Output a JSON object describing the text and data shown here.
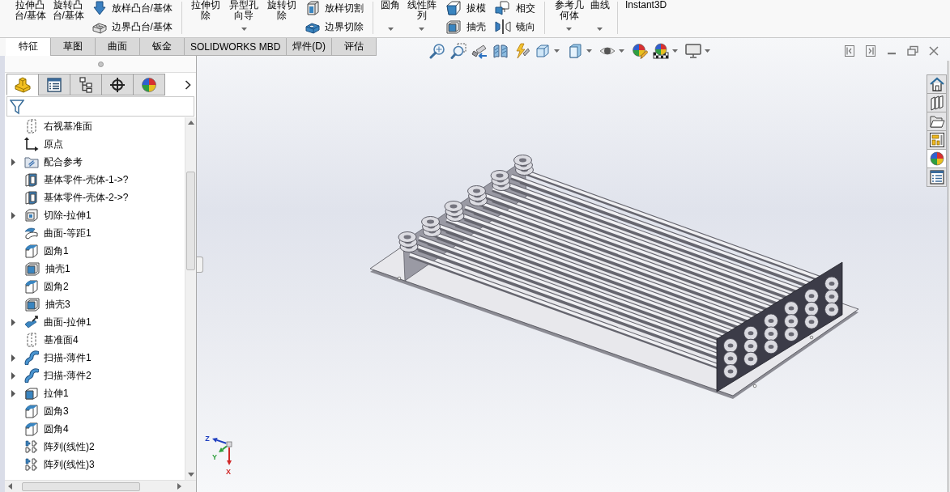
{
  "ribbon": {
    "groups": [
      {
        "items": [
          {
            "kind": "large",
            "label": "拉伸凸台/基体",
            "dropdown": false
          },
          {
            "kind": "large",
            "label": "旋转凸台/基体",
            "dropdown": false
          },
          {
            "kind": "stack",
            "buttons": [
              {
                "kind": "loft",
                "label": "放样凸台/基体"
              },
              {
                "kind": "boundary",
                "label": "边界凸台/基体"
              }
            ]
          }
        ]
      },
      {
        "items": [
          {
            "kind": "large",
            "label": "拉伸切除",
            "dropdown": false
          },
          {
            "kind": "large",
            "label": "异型孔向导",
            "dropdown": true
          },
          {
            "kind": "large",
            "label": "旋转切除",
            "dropdown": false
          },
          {
            "kind": "stack",
            "buttons": [
              {
                "kind": "loft-cut",
                "label": "放样切割"
              },
              {
                "kind": "boundary-cut",
                "label": "边界切除"
              }
            ]
          }
        ]
      },
      {
        "items": [
          {
            "kind": "large",
            "label": "圆角",
            "dropdown": true
          },
          {
            "kind": "large",
            "label": "线性阵列",
            "dropdown": true
          },
          {
            "kind": "stack",
            "buttons": [
              {
                "kind": "draft",
                "label": "拔模"
              },
              {
                "kind": "shell",
                "label": "抽壳"
              }
            ]
          },
          {
            "kind": "stack",
            "buttons": [
              {
                "kind": "intersect",
                "label": "相交"
              },
              {
                "kind": "mirror",
                "label": "镜向"
              }
            ]
          }
        ]
      },
      {
        "items": [
          {
            "kind": "large",
            "label": "参考几何体",
            "dropdown": true
          },
          {
            "kind": "large",
            "label": "曲线",
            "dropdown": true
          }
        ]
      },
      {
        "items": [
          {
            "kind": "large",
            "label": "Instant3D",
            "dropdown": false
          }
        ]
      }
    ]
  },
  "command_tabs": [
    {
      "label": "特征",
      "selected": true
    },
    {
      "label": "草图",
      "selected": false
    },
    {
      "label": "曲面",
      "selected": false
    },
    {
      "label": "钣金",
      "selected": false
    },
    {
      "label": "SOLIDWORKS MBD",
      "selected": false
    },
    {
      "label": "焊件(D)",
      "selected": false
    },
    {
      "label": "评估",
      "selected": false
    }
  ],
  "view_toolbar": [
    {
      "kind": "zoom-fit",
      "dropdown": false
    },
    {
      "kind": "zoom-area",
      "dropdown": false
    },
    {
      "kind": "previous-view",
      "dropdown": false
    },
    {
      "kind": "section-view",
      "dropdown": false
    },
    {
      "kind": "dynamic-annotation",
      "dropdown": false
    },
    {
      "kind": "view-orientation",
      "dropdown": true
    },
    {
      "kind": "display-style",
      "dropdown": true
    },
    {
      "kind": "hide-show",
      "dropdown": true
    },
    {
      "kind": "edit-appearance",
      "dropdown": false
    },
    {
      "kind": "apply-scene",
      "dropdown": true
    },
    {
      "kind": "view-settings",
      "dropdown": true
    }
  ],
  "window_controls": [
    {
      "kind": "tile-left"
    },
    {
      "kind": "tile-right"
    },
    {
      "kind": "minimize"
    },
    {
      "kind": "restore"
    },
    {
      "kind": "close"
    }
  ],
  "feature_panel": {
    "tabs": [
      {
        "kind": "feature-manager",
        "selected": true
      },
      {
        "kind": "property-manager",
        "selected": false
      },
      {
        "kind": "configuration-manager",
        "selected": false
      },
      {
        "kind": "dimxpert-manager",
        "selected": false
      },
      {
        "kind": "display-manager",
        "selected": false
      }
    ],
    "tree": [
      {
        "kind": "plane",
        "label": "右视基准面",
        "expandable": false
      },
      {
        "kind": "origin",
        "label": "原点",
        "expandable": false
      },
      {
        "kind": "folder",
        "label": "配合参考",
        "expandable": true
      },
      {
        "kind": "body",
        "label": "基体零件-壳体-1->?",
        "expandable": false
      },
      {
        "kind": "body",
        "label": "基体零件-壳体-2->?",
        "expandable": false
      },
      {
        "kind": "cut",
        "label": "切除-拉伸1",
        "expandable": true
      },
      {
        "kind": "offset",
        "label": "曲面-等距1",
        "expandable": false
      },
      {
        "kind": "fillet",
        "label": "圆角1",
        "expandable": false
      },
      {
        "kind": "shell",
        "label": "抽壳1",
        "expandable": false
      },
      {
        "kind": "fillet",
        "label": "圆角2",
        "expandable": false
      },
      {
        "kind": "shell",
        "label": "抽壳3",
        "expandable": false
      },
      {
        "kind": "surface-extrude",
        "label": "曲面-拉伸1",
        "expandable": true
      },
      {
        "kind": "plane",
        "label": "基准面4",
        "expandable": false
      },
      {
        "kind": "sweep",
        "label": "扫描-薄件1",
        "expandable": true
      },
      {
        "kind": "sweep",
        "label": "扫描-薄件2",
        "expandable": true
      },
      {
        "kind": "extrude",
        "label": "拉伸1",
        "expandable": true
      },
      {
        "kind": "fillet",
        "label": "圆角3",
        "expandable": false
      },
      {
        "kind": "fillet",
        "label": "圆角4",
        "expandable": false
      },
      {
        "kind": "pattern",
        "label": "阵列(线性)2",
        "expandable": false
      },
      {
        "kind": "pattern",
        "label": "阵列(线性)3",
        "expandable": false
      }
    ]
  },
  "task_pane": [
    {
      "kind": "home",
      "selected": false
    },
    {
      "kind": "design-library",
      "selected": false
    },
    {
      "kind": "file-explorer",
      "selected": false
    },
    {
      "kind": "view-palette",
      "selected": false
    },
    {
      "kind": "appearances",
      "selected": true
    },
    {
      "kind": "custom-properties",
      "selected": false
    }
  ],
  "triad": {
    "axes": [
      {
        "label": "Z",
        "color": "#1f3fbf"
      },
      {
        "label": "Y",
        "color": "#2e9e3a"
      },
      {
        "label": "X",
        "color": "#d02828"
      }
    ]
  }
}
